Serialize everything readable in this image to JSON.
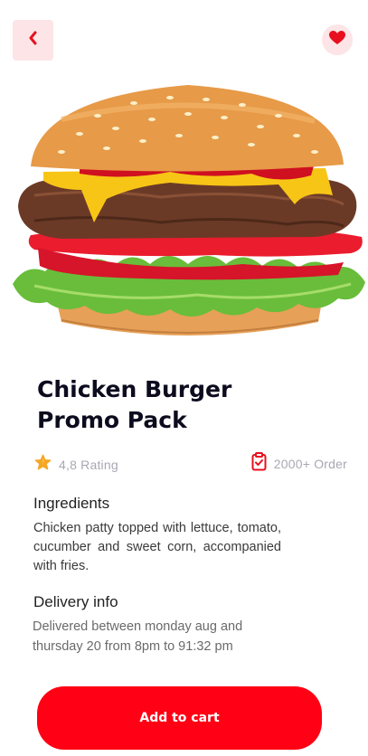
{
  "header": {
    "back_icon": "chevron-left-icon",
    "favorite_icon": "heart-icon"
  },
  "product": {
    "image": "burger-photo",
    "title_line1": "Chicken Burger",
    "title_line2": "Promo Pack",
    "rating_icon": "star-icon",
    "rating_text": "4,8 Rating",
    "orders_icon": "clipboard-check-icon",
    "orders_text": "2000+ Order"
  },
  "ingredients": {
    "heading": "Ingredients",
    "text": "Chicken patty topped with lettuce, tomato, cucumber and sweet corn, accompanied with fries."
  },
  "delivery": {
    "heading": "Delivery info",
    "text": "Delivered between monday aug and thursday 20 from 8pm to 91:32 pm"
  },
  "actions": {
    "add_to_cart_label": "Add to cart"
  },
  "colors": {
    "accent": "#ff0014",
    "accent_soft": "#fde4e6",
    "star": "#f5a623",
    "title": "#0d0b1e",
    "muted": "#a8a8b3"
  }
}
